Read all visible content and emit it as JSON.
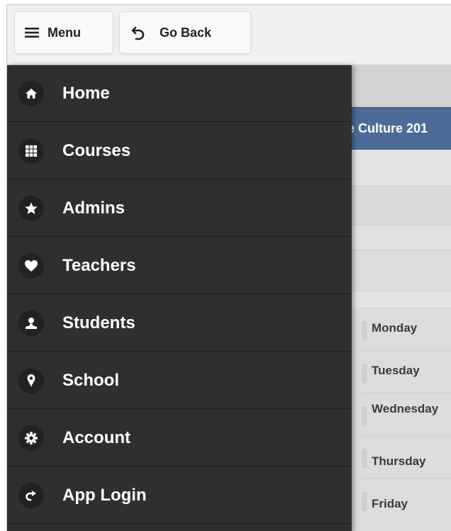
{
  "toolbar": {
    "menu_label": "Menu",
    "menu_icon": "hamburger-icon",
    "back_label": "Go Back",
    "back_icon": "undo-arrow-icon"
  },
  "drawer": {
    "items": [
      {
        "label": "Home",
        "icon": "home-icon"
      },
      {
        "label": "Courses",
        "icon": "grid-icon"
      },
      {
        "label": "Admins",
        "icon": "star-icon"
      },
      {
        "label": "Teachers",
        "icon": "heart-icon"
      },
      {
        "label": "Students",
        "icon": "user-icon"
      },
      {
        "label": "School",
        "icon": "map-pin-icon"
      },
      {
        "label": "Account",
        "icon": "gear-icon"
      },
      {
        "label": "App Login",
        "icon": "share-arrow-icon"
      }
    ]
  },
  "background_page": {
    "title_fragment": "e Culture 201",
    "days": [
      "Monday",
      "Tuesday",
      "Wednesday",
      "Thursday",
      "Friday"
    ]
  },
  "colors": {
    "drawer_bg": "#2f2f2f",
    "title_band": "#4d6b99",
    "toolbar_bg": "#f0f0f0"
  }
}
